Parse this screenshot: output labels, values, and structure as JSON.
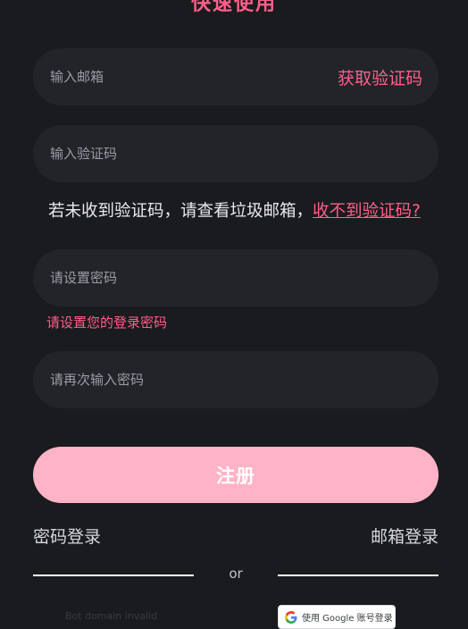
{
  "header": {
    "title": "快速使用"
  },
  "form": {
    "email": {
      "placeholder": "输入邮箱",
      "value": "",
      "get_code_label": "获取验证码"
    },
    "code": {
      "placeholder": "输入验证码",
      "value": ""
    },
    "hint": {
      "text": "若未收到验证码，请查看垃圾邮箱，",
      "link_label": "收不到验证码?"
    },
    "password": {
      "placeholder": "请设置密码",
      "value": "",
      "error": "请设置您的登录密码"
    },
    "confirm_password": {
      "placeholder": "请再次输入密码",
      "value": ""
    },
    "register_label": "注册"
  },
  "alt_login": {
    "password_login": "密码登录",
    "email_login": "邮箱登录"
  },
  "divider": {
    "label": "or"
  },
  "third_party": {
    "bot_error": "Bot domain invalid",
    "google_label": "使用 Google 账号登录"
  },
  "colors": {
    "background": "#1a1b1e",
    "field": "#232429",
    "accent": "#ff5f8a",
    "register_button": "#ffb3c7"
  },
  "icons": {
    "google": "google-g-icon"
  }
}
